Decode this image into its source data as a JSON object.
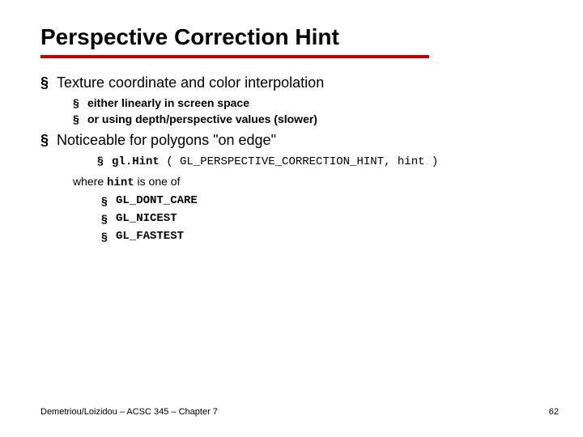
{
  "title": "Perspective Correction Hint",
  "bullets": {
    "b1": "Texture coordinate and color interpolation",
    "b1_1": "either linearly in screen space",
    "b1_2": "or using depth/perspective values (slower)",
    "b2": "Noticeable for polygons \"on edge\"",
    "code_fn": "gl.Hint",
    "code_open": " ( ",
    "code_arg1": "GL_PERSPECTIVE_CORRECTION_HINT",
    "code_sep": ", ",
    "code_arg2": "hint",
    "code_close": " )",
    "where_pre": "where ",
    "where_code": "hint",
    "where_post": " is one of",
    "h1": "GL_DONT_CARE",
    "h2": "GL_NICEST",
    "h3": "GL_FASTEST"
  },
  "footer": {
    "left": "Demetriou/Loizidou – ACSC 345 – Chapter 7",
    "right": "62"
  }
}
